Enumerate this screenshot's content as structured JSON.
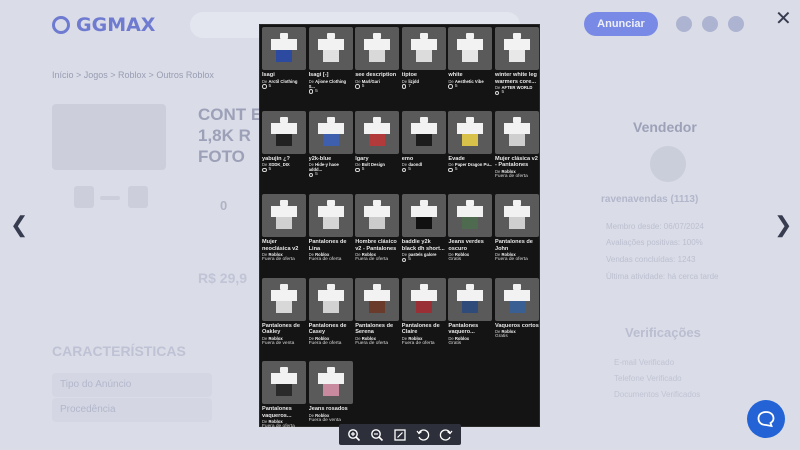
{
  "background": {
    "logo_text": "GGMAX",
    "anunciar_label": "Anunciar",
    "breadcrumb": "Início  >  Jogos  >  Roblox  >  Outros Roblox",
    "title_fragment": "CONT E 1,8K R FOTO",
    "quantity": "0",
    "price_fragment": "R$ 29,9",
    "caracteristicas": "CARACTERÍSTICAS",
    "tipo_label": "Tipo do Anúncio",
    "procedencia_label": "Procedência",
    "vendedor_title": "Vendedor",
    "seller_name": "ravenavendas",
    "seller_rating": "(1113)",
    "seller_rows": [
      "Membro desde: 06/07/2024",
      "Avaliações positivas: 100%",
      "Vendas concluídas: 1243",
      "Última atividade: há cerca tarde"
    ],
    "verificacoes_title": "Verificações",
    "verificacoes_rows": [
      "E-mail Verificado",
      "Telefone Verificado",
      "Documentos Verificados"
    ]
  },
  "viewer": {
    "items": [
      {
        "name": "Isagi",
        "creator": "Arctil Clothing",
        "meta": "5",
        "meta_type": "coin",
        "accent": "#2b4aa0"
      },
      {
        "name": "Isagi [-]",
        "creator": "Ajione Clothing S...",
        "meta": "5",
        "meta_type": "coin",
        "accent": "#e0e0e0"
      },
      {
        "name": "see description",
        "creator": "Marl/Gari",
        "meta": "5",
        "meta_type": "coin",
        "accent": "#d9d9d9"
      },
      {
        "name": "tiptoe",
        "creator": "lizjdd",
        "meta": "7",
        "meta_type": "coin",
        "accent": "#dcdcdc"
      },
      {
        "name": "white",
        "creator": "Aesthetic Vibe",
        "meta": "5",
        "meta_type": "coin",
        "accent": "#e5e5e5"
      },
      {
        "name": "winter white leg warmers core...",
        "creator": "AFTER WORLD",
        "meta": "5",
        "meta_type": "coin",
        "accent": "#e8e8e8"
      },
      {
        "name": "yabujin ¿?",
        "creator": "XDDK_DIX",
        "meta": "5",
        "meta_type": "coin",
        "accent": "#222222"
      },
      {
        "name": "y2k-blue",
        "creator": "Hide-y haoe addd...",
        "meta": "5",
        "meta_type": "coin",
        "accent": "#3d5fae"
      },
      {
        "name": "lgary",
        "creator": "Bolt Design",
        "meta": "5",
        "meta_type": "coin",
        "accent": "#b33a3a"
      },
      {
        "name": "emo",
        "creator": "daondl",
        "meta": "5",
        "meta_type": "coin",
        "accent": "#1c1c1c"
      },
      {
        "name": "Evade",
        "creator": "Paper Dragon Pu...",
        "meta": "5",
        "meta_type": "coin",
        "accent": "#d9c24a"
      },
      {
        "name": "Mujer clásica v2 - Pantalones",
        "creator": "Roblox",
        "meta": "Fuera de oferta",
        "meta_type": "text",
        "accent": "#cfcfcf"
      },
      {
        "name": "Mujer neoclásica v2 -...",
        "creator": "Roblox",
        "meta": "Fuera de oferta",
        "meta_type": "text",
        "accent": "#d0d0d0"
      },
      {
        "name": "Pantalones de Lina",
        "creator": "Roblox",
        "meta": "Fuera de oferta",
        "meta_type": "text",
        "accent": "#d5d5d5"
      },
      {
        "name": "Hombre clásico v2 - Pantalones",
        "creator": "Roblox",
        "meta": "Fuera de oferta",
        "meta_type": "text",
        "accent": "#cccccc"
      },
      {
        "name": "baddie y2k black dh short...",
        "creator": "pastels galore",
        "meta": "5",
        "meta_type": "coin",
        "accent": "#111111"
      },
      {
        "name": "Jeans verdes oscuro",
        "creator": "Roblox",
        "meta": "Gratis",
        "meta_type": "text",
        "accent": "#4f6b4f"
      },
      {
        "name": "Pantalones de John",
        "creator": "Roblox",
        "meta": "Fuera de oferta",
        "meta_type": "text",
        "accent": "#cfcfcf"
      },
      {
        "name": "Pantalones de Oakley",
        "creator": "Roblox",
        "meta": "Fuera de venta",
        "meta_type": "text",
        "accent": "#d8d8d8"
      },
      {
        "name": "Pantalones de Casey",
        "creator": "Roblox",
        "meta": "Fuera de oferta",
        "meta_type": "text",
        "accent": "#d2d2d2"
      },
      {
        "name": "Pantalones de Serena",
        "creator": "Roblox",
        "meta": "Fuera de oferta",
        "meta_type": "text",
        "accent": "#6a3a2a"
      },
      {
        "name": "Pantalones de Claire",
        "creator": "Roblox",
        "meta": "Fuera de oferta",
        "meta_type": "text",
        "accent": "#9a2f36"
      },
      {
        "name": "Pantalones vaquero...",
        "creator": "Roblox",
        "meta": "Gratis",
        "meta_type": "text",
        "accent": "#2f4b7a"
      },
      {
        "name": "Vaqueros cortos",
        "creator": "Roblox",
        "meta": "Gratis",
        "meta_type": "text",
        "accent": "#3a5f93"
      },
      {
        "name": "Pantalones vaqueros...",
        "creator": "Roblox",
        "meta": "Fuera de oferta",
        "meta_type": "text",
        "accent": "#2a2a2a"
      },
      {
        "name": "Jeans rosados",
        "creator": "Roblox",
        "meta": "Fuera de venta",
        "meta_type": "text",
        "accent": "#c98aa0"
      }
    ]
  },
  "labels": {
    "creator_prefix": "De"
  }
}
